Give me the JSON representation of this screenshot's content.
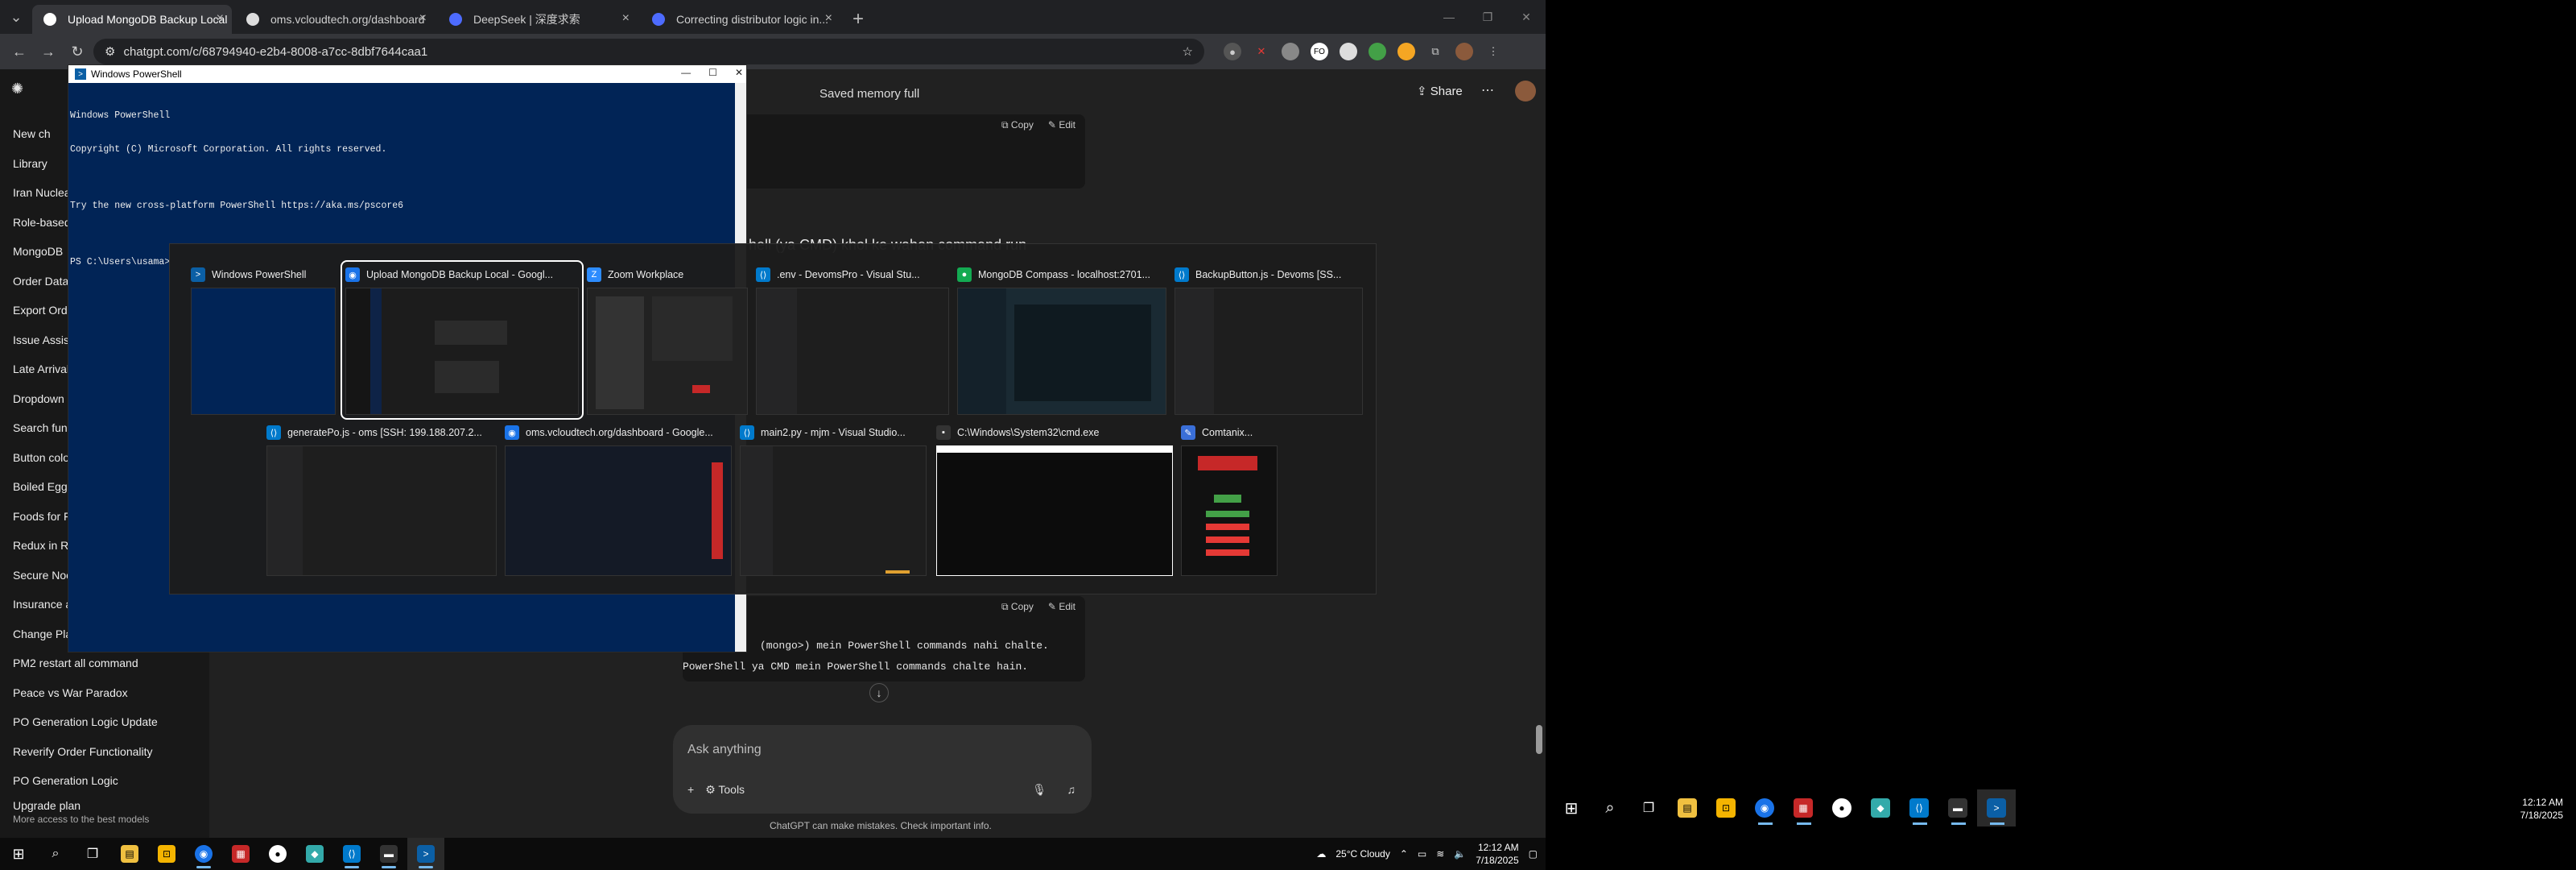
{
  "browser": {
    "tabs": [
      {
        "label": "Upload MongoDB Backup Local",
        "active": true,
        "icon": "chatgpt-icon"
      },
      {
        "label": "oms.vcloudtech.org/dashboard",
        "active": false,
        "icon": "site-icon"
      },
      {
        "label": "DeepSeek | 深度求索",
        "active": false,
        "icon": "deepseek-icon"
      },
      {
        "label": "Correcting distributor logic in...",
        "active": false,
        "icon": "deepseek-icon"
      }
    ],
    "url": "chatgpt.com/c/68794940-e2b4-8008-a7cc-8dbf7644caa1"
  },
  "chatgpt": {
    "header_title": "Saved memory full",
    "share_label": "Share",
    "sidebar_items": [
      "New ch",
      "Library",
      "Iran Nuclea",
      "Role-based",
      "MongoDB",
      "Order Data",
      "Export Orde",
      "Issue Assist",
      "Late Arrival",
      "Dropdown",
      "Search func",
      "Button colo",
      "Boiled Eggs",
      "Foods for F",
      "Redux in Re",
      "Secure Noc",
      "Insurance a",
      "Change Pla",
      "PM2 restart all command",
      "Peace vs War Paradox",
      "PO Generation Logic Update",
      "Reverify Order Functionality",
      "PO Generation Logic"
    ],
    "upgrade_title": "Upgrade plan",
    "upgrade_sub": "More access to the best models",
    "copy_label": "Copy",
    "edit_label": "Edit",
    "heading_partial": "hell (ya CMD) khol ke wahan command run",
    "line1": "(mongo>) mein PowerShell commands nahi chalte.",
    "line2": "PowerShell ya CMD mein PowerShell commands chalte hain.",
    "composer_placeholder": "Ask anything",
    "tools_label": "Tools",
    "disclaimer": "ChatGPT can make mistakes. Check important info."
  },
  "powershell": {
    "title": "Windows PowerShell",
    "lines": [
      "Windows PowerShell",
      "Copyright (C) Microsoft Corporation. All rights reserved.",
      "",
      "Try the new cross-platform PowerShell https://aka.ms/pscore6",
      "",
      "PS C:\\Users\\usama>"
    ]
  },
  "switcher": {
    "row1": [
      {
        "label": "Windows PowerShell",
        "icon": "powershell-icon",
        "color": "#0b5fa5"
      },
      {
        "label": "Upload MongoDB Backup Local - Googl...",
        "icon": "chrome-icon",
        "color": "#1a73e8",
        "selected": true
      },
      {
        "label": "Zoom Workplace",
        "icon": "zoom-icon",
        "color": "#2d8cff"
      },
      {
        "label": ".env - DevomsPro - Visual Stu...",
        "icon": "vscode-icon",
        "color": "#007acc"
      },
      {
        "label": "MongoDB Compass - localhost:2701...",
        "icon": "compass-icon",
        "color": "#13aa52"
      },
      {
        "label": "BackupButton.js - Devoms [SS...",
        "icon": "vscode-icon",
        "color": "#007acc"
      }
    ],
    "row2": [
      {
        "label": "generatePo.js - oms [SSH: 199.188.207.2...",
        "icon": "vscode-icon",
        "color": "#007acc"
      },
      {
        "label": "oms.vcloudtech.org/dashboard - Google...",
        "icon": "chrome-icon",
        "color": "#1a73e8"
      },
      {
        "label": "main2.py - mjm - Visual Studio...",
        "icon": "vscode-icon",
        "color": "#007acc"
      },
      {
        "label": "C:\\Windows\\System32\\cmd.exe",
        "icon": "cmd-icon",
        "color": "#333333"
      },
      {
        "label": "Comtanix...",
        "icon": "feather-icon",
        "color": "#3a6fd8"
      }
    ]
  },
  "taskbar": {
    "weather": "25°C  Cloudy",
    "time": "12:12 AM",
    "date": "7/18/2025"
  },
  "taskbar2": {
    "time": "12:12 AM",
    "date": "7/18/2025"
  }
}
